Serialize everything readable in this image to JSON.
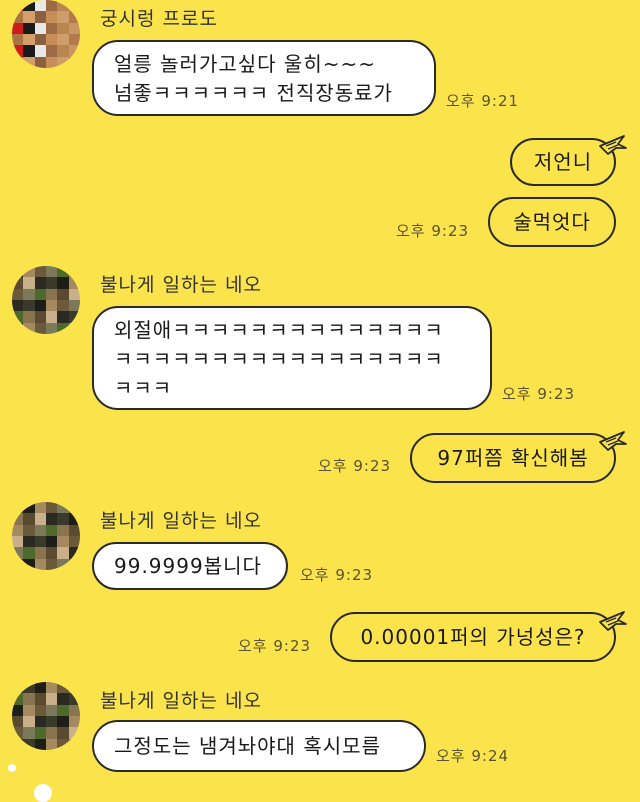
{
  "colors": {
    "background": "#fbe44b",
    "bubble_left": "#ffffff",
    "bubble_right": "#fbe44b",
    "border": "#2a2a2a"
  },
  "messages": [
    {
      "sender": "궁시렁 프로도",
      "text": "얼릉 놀러가고싶다 울히~~~\n넘좋ㅋㅋㅋㅋㅋㅋ 전직장동료가",
      "time": "오후 9:21"
    },
    {
      "text": "저언니",
      "time": ""
    },
    {
      "text": "술먹엇다",
      "time": "오후 9:23"
    },
    {
      "sender": "불나게 일하는 네오",
      "text": "외절애ㅋㅋㅋㅋㅋㅋㅋㅋㅋㅋㅋㅋㅋㅋ\nㅋㅋㅋㅋㅋㅋㅋㅋㅋㅋㅋㅋㅋㅋㅋㅋㅋ\nㅋㅋㅋ",
      "time": "오후 9:23"
    },
    {
      "text": "97퍼쯤 확신해봄",
      "time": "오후 9:23"
    },
    {
      "sender": "불나게 일하는 네오",
      "text": "99.9999봅니다",
      "time": "오후 9:23"
    },
    {
      "text": "0.00001퍼의 가넝성은?",
      "time": "오후 9:23"
    },
    {
      "sender": "불나게 일하는 네오",
      "text": "그정도는 냄겨놔야대 혹시모름",
      "time": "오후 9:24"
    }
  ]
}
